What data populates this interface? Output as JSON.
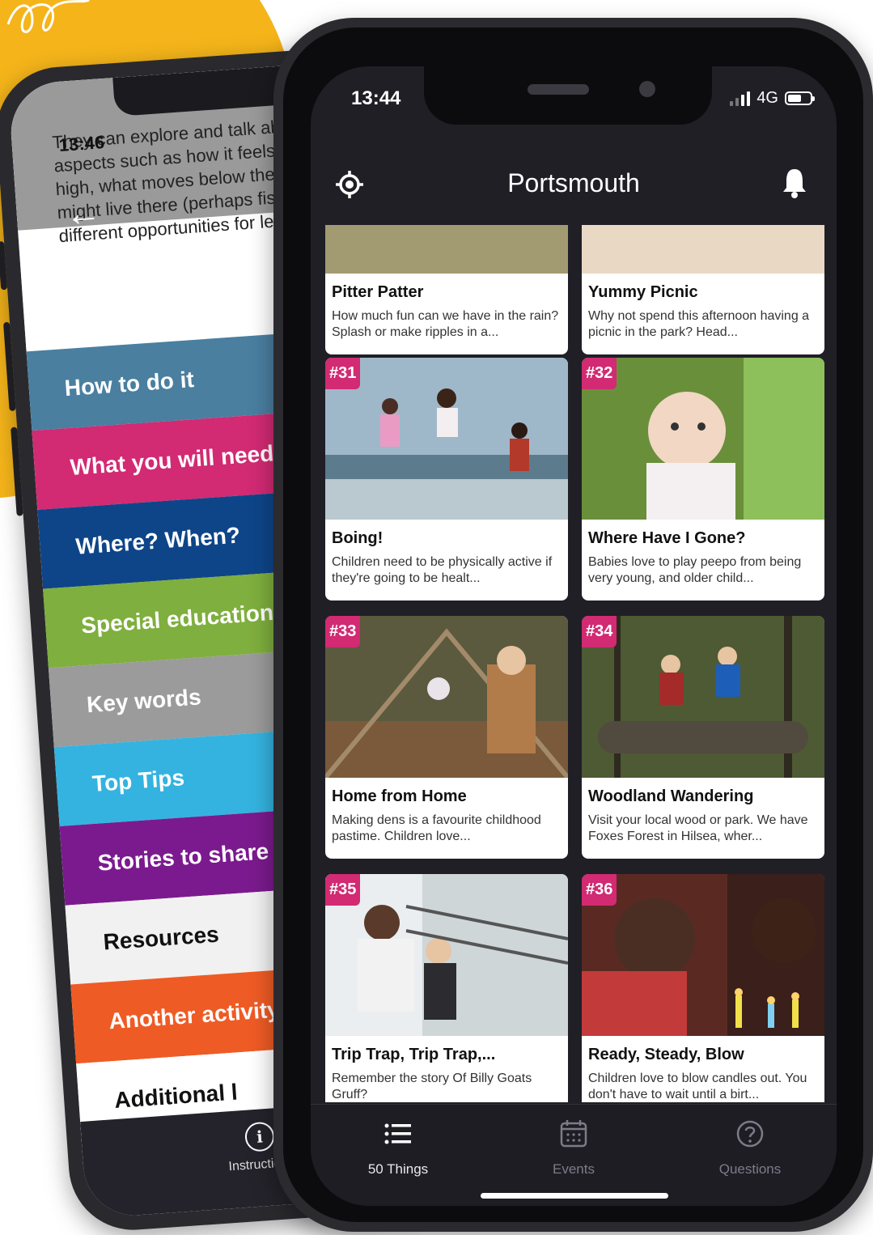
{
  "colors": {
    "accent_yellow": "#f4b41a",
    "badge_magenta": "#d22a73",
    "app_background": "#201f26",
    "tab_inactive": "#7d7b88"
  },
  "back_phone": {
    "status_time": "13:46",
    "back_icon": "arrow-left-icon",
    "paragraph": "They can explore and talk about aspects such as how it feels to be up high, what moves below them, what might live there (perhaps fish). Lots of different opportunities for learning",
    "menu": [
      {
        "label": "How to do it",
        "color": "#4a7fa0"
      },
      {
        "label": "What you will need",
        "color": "#d22a73"
      },
      {
        "label": "Where? When?",
        "color": "#0e4589"
      },
      {
        "label": "Special educational",
        "color": "#7faf3e"
      },
      {
        "label": "Key words",
        "color": "#9b9b9b"
      },
      {
        "label": "Top Tips",
        "color": "#34b3e0"
      },
      {
        "label": "Stories to share",
        "color": "#7b1a8e"
      },
      {
        "label": "Resources",
        "color": "#f1f1f1"
      },
      {
        "label": "Another activity",
        "color": "#ef5b25"
      },
      {
        "label": "Additional l",
        "color": "#ffffff"
      }
    ],
    "tab": {
      "icon": "info-icon",
      "label": "Instructions"
    }
  },
  "front_phone": {
    "status": {
      "time": "13:44",
      "network": "4G"
    },
    "header": {
      "title": "Portsmouth",
      "left_icon": "locate-icon",
      "right_icon": "bell-icon"
    },
    "cards": [
      {
        "badge": "",
        "title": "Pitter Patter",
        "desc": "How much fun can we have in the rain? Splash or make ripples in a..."
      },
      {
        "badge": "",
        "title": "Yummy Picnic",
        "desc": "Why not spend this afternoon having a picnic in the park? Head..."
      },
      {
        "badge": "#31",
        "title": "Boing!",
        "desc": "Children need to be physically active if they're going to be healt..."
      },
      {
        "badge": "#32",
        "title": "Where Have I Gone?",
        "desc": "Babies love to play peepo from being very young, and older child..."
      },
      {
        "badge": "#33",
        "title": "Home from Home",
        "desc": "Making dens is a favourite childhood pastime. Children love..."
      },
      {
        "badge": "#34",
        "title": "Woodland Wandering",
        "desc": "Visit your local wood or park. We have Foxes Forest in Hilsea, wher..."
      },
      {
        "badge": "#35",
        "title": "Trip Trap, Trip Trap,...",
        "desc": "Remember the story Of Billy Goats Gruff?"
      },
      {
        "badge": "#36",
        "title": "Ready, Steady, Blow",
        "desc": "Children love to blow candles out. You don't have to wait until a birt..."
      }
    ],
    "tabs": [
      {
        "label": "50 Things",
        "icon": "list-icon",
        "active": true
      },
      {
        "label": "Events",
        "icon": "calendar-icon",
        "active": false
      },
      {
        "label": "Questions",
        "icon": "question-icon",
        "active": false
      }
    ]
  }
}
